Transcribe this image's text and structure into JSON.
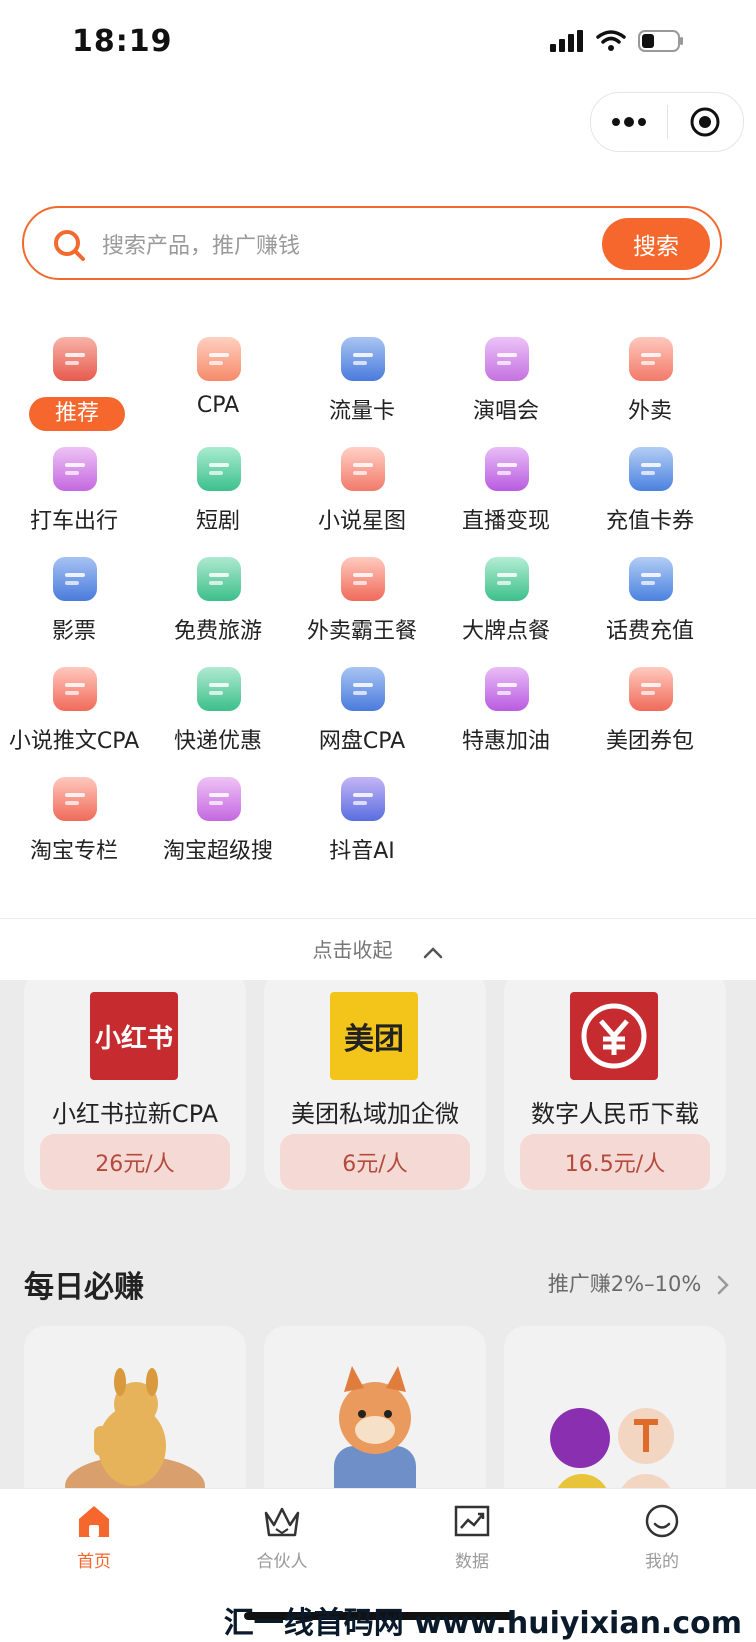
{
  "status_bar": {
    "time": "18:19"
  },
  "search": {
    "placeholder": "搜索产品，推广赚钱",
    "button": "搜索"
  },
  "categories": [
    {
      "label": "推荐",
      "icon": "recommend-badge-icon"
    },
    {
      "label": "CPA",
      "icon": "user-add-icon"
    },
    {
      "label": "流量卡",
      "icon": "sim-card-icon"
    },
    {
      "label": "演唱会",
      "icon": "microphone-icon"
    },
    {
      "label": "外卖",
      "icon": "takeout-box-icon"
    },
    {
      "label": "打车出行",
      "icon": "taxi-icon"
    },
    {
      "label": "短剧",
      "icon": "tv-play-icon"
    },
    {
      "label": "小说星图",
      "icon": "open-book-icon"
    },
    {
      "label": "直播变现",
      "icon": "video-camera-icon"
    },
    {
      "label": "充值卡券",
      "icon": "receipt-icon"
    },
    {
      "label": "影票",
      "icon": "film-reel-icon"
    },
    {
      "label": "免费旅游",
      "icon": "airplane-icon"
    },
    {
      "label": "外卖霸王餐",
      "icon": "food-cloche-icon"
    },
    {
      "label": "大牌点餐",
      "icon": "chef-hat-icon"
    },
    {
      "label": "话费充值",
      "icon": "phone-yuan-icon"
    },
    {
      "label": "小说推文CPA",
      "icon": "book-shelf-icon"
    },
    {
      "label": "快递优惠",
      "icon": "package-icon"
    },
    {
      "label": "网盘CPA",
      "icon": "cloud-icon"
    },
    {
      "label": "特惠加油",
      "icon": "fuel-pump-icon"
    },
    {
      "label": "美团券包",
      "icon": "rabbit-ears-icon"
    },
    {
      "label": "淘宝专栏",
      "icon": "taobao-icon"
    },
    {
      "label": "淘宝超级搜",
      "icon": "taobao-icon"
    },
    {
      "label": "抖音AI",
      "icon": "scissors-icon"
    }
  ],
  "collapse_label": "点击收起",
  "featured": [
    {
      "title": "小红书拉新CPA",
      "price": "26元/人",
      "logo_text": "小红书",
      "logo_bg": "#c62b2f",
      "logo_fg": "#ffffff"
    },
    {
      "title": "美团私域加企微",
      "price": "6元/人",
      "logo_text": "美团",
      "logo_bg": "#f3c51b",
      "logo_fg": "#222222"
    },
    {
      "title": "数字人民币下载",
      "price": "16.5元/人",
      "logo_text": "",
      "logo_bg": "#c62b2f",
      "logo_fg": "#ffffff"
    }
  ],
  "daily": {
    "title": "每日必赚",
    "more": "推广赚2%–10%"
  },
  "tabs": [
    {
      "label": "首页",
      "icon": "home-icon",
      "active": true
    },
    {
      "label": "合伙人",
      "icon": "crown-icon",
      "active": false
    },
    {
      "label": "数据",
      "icon": "chart-icon",
      "active": false
    },
    {
      "label": "我的",
      "icon": "smile-icon",
      "active": false
    }
  ],
  "watermark": "汇一线首码网 www.huiyixian.com",
  "colors": {
    "accent": "#f5672d"
  }
}
